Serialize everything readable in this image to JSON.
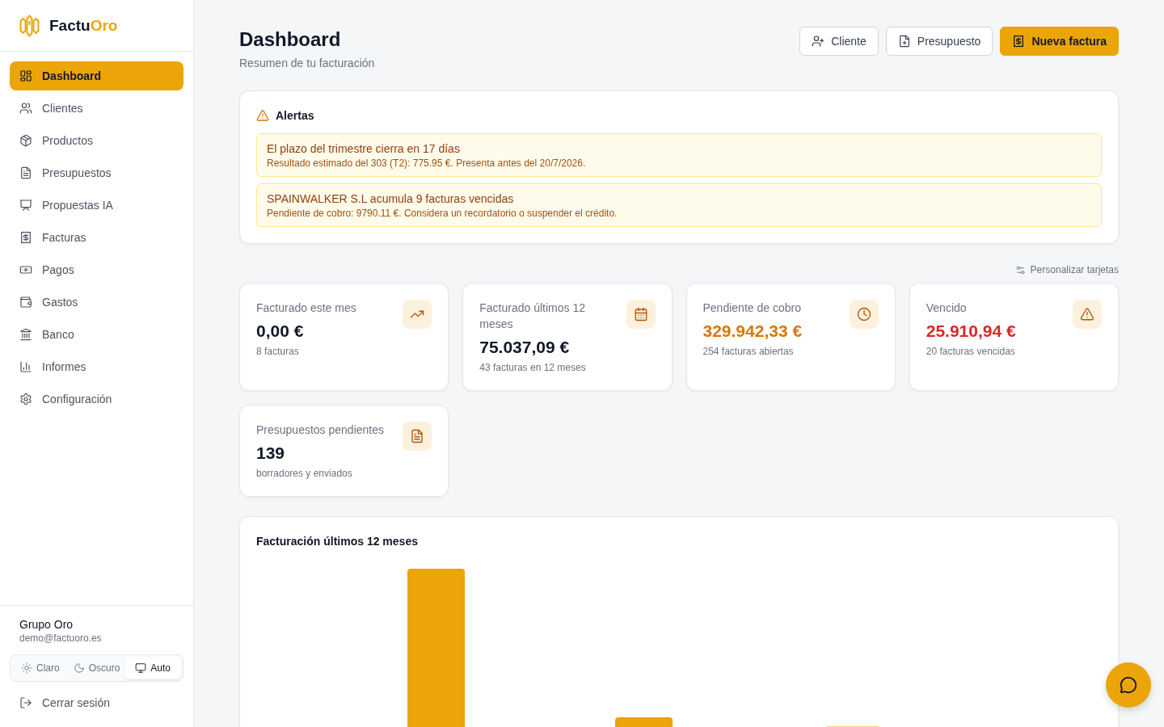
{
  "sidebar": {
    "brand": {
      "name": "Factu",
      "accent": "Oro"
    },
    "nav": [
      {
        "label": "Dashboard",
        "selected": true
      },
      {
        "label": "Clientes",
        "selected": false
      },
      {
        "label": "Productos",
        "selected": false
      },
      {
        "label": "Presupuestos",
        "selected": false
      },
      {
        "label": "Propuestas IA",
        "selected": false
      },
      {
        "label": "Facturas",
        "selected": false
      },
      {
        "label": "Pagos",
        "selected": false
      },
      {
        "label": "Gastos",
        "selected": false
      },
      {
        "label": "Banco",
        "selected": false
      },
      {
        "label": "Informes",
        "selected": false
      },
      {
        "label": "Configuración",
        "selected": false
      }
    ],
    "account": {
      "name": "Grupo Oro",
      "email": "demo@factuoro.es"
    },
    "theme_options": [
      {
        "label": "Claro",
        "selected": false
      },
      {
        "label": "Oscuro",
        "selected": false
      },
      {
        "label": "Auto",
        "selected": true
      }
    ],
    "logout": "Cerrar sesión"
  },
  "header": {
    "title": "Dashboard",
    "subtitle": "Resumen de tu facturación",
    "buttons": [
      {
        "label": "Cliente",
        "kind": "secondary"
      },
      {
        "label": "Presupuesto",
        "kind": "secondary"
      },
      {
        "label": "Nueva factura",
        "kind": "primary"
      }
    ]
  },
  "alerts": {
    "title": "Alertas",
    "items": [
      {
        "title": "El plazo del trimestre cierra en 17 días",
        "detail": "Resultado estimado del 303 (T2): 775.95 €. Presenta antes del 20/7/2026."
      },
      {
        "title": "SPAINWALKER S.L acumula 9 facturas vencidas",
        "detail": "Pendiente de cobro: 9790.11 €. Considera un recordatorio o suspender el crédito."
      }
    ]
  },
  "cards_toolbar": {
    "customize": "Personalizar tarjetas"
  },
  "cards": [
    {
      "label": "Facturado este mes",
      "value": "0,00 €",
      "note": "8 facturas",
      "color": "#111827"
    },
    {
      "label": "Facturado últimos 12 meses",
      "value": "75.037,09 €",
      "note": "43 facturas en 12 meses",
      "color": "#111827"
    },
    {
      "label": "Pendiente de cobro",
      "value": "329.942,33 €",
      "note": "254 facturas abiertas",
      "color": "#d97706"
    },
    {
      "label": "Vencido",
      "value": "25.910,94 €",
      "note": "20 facturas vencidas",
      "color": "#dc2626"
    },
    {
      "label": "Presupuestos pendientes",
      "value": "139",
      "note": "borradores y enviados",
      "color": "#111827"
    }
  ],
  "revenue_chart": {
    "title": "Facturación últimos 12 meses"
  }
}
